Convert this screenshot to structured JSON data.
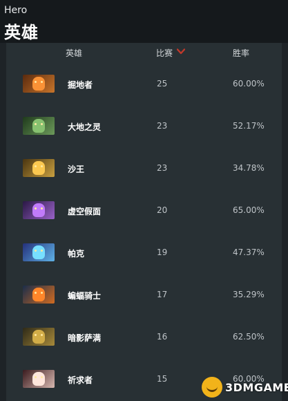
{
  "header": {
    "small_title": "Hero",
    "big_title": "英雄"
  },
  "table": {
    "col_hero": "英雄",
    "col_matches": "比赛",
    "col_winrate": "胜率",
    "sort_icon": "chevron-down-icon",
    "sort_color": "#c0392b"
  },
  "rows": [
    {
      "hero": "掘地者",
      "matches": "25",
      "winrate": "60.00%",
      "portrait_colors": [
        "#5a2a0e",
        "#c8752b"
      ]
    },
    {
      "hero": "大地之灵",
      "matches": "23",
      "winrate": "52.17%",
      "portrait_colors": [
        "#1f3a1c",
        "#6c9a5a"
      ]
    },
    {
      "hero": "沙王",
      "matches": "23",
      "winrate": "34.78%",
      "portrait_colors": [
        "#4a3510",
        "#c9a040"
      ]
    },
    {
      "hero": "虚空假面",
      "matches": "20",
      "winrate": "65.00%",
      "portrait_colors": [
        "#2a1845",
        "#9a62c8"
      ]
    },
    {
      "hero": "帕克",
      "matches": "19",
      "winrate": "47.37%",
      "portrait_colors": [
        "#24307a",
        "#5fb2e6"
      ]
    },
    {
      "hero": "蝙蝠骑士",
      "matches": "17",
      "winrate": "35.29%",
      "portrait_colors": [
        "#1a2d4a",
        "#d06b22"
      ]
    },
    {
      "hero": "暗影萨满",
      "matches": "16",
      "winrate": "62.50%",
      "portrait_colors": [
        "#2e2a18",
        "#a88a3a"
      ]
    },
    {
      "hero": "祈求者",
      "matches": "15",
      "winrate": "60.00%",
      "portrait_colors": [
        "#3a1a1e",
        "#d8b8b0"
      ]
    }
  ],
  "watermark": {
    "text": "3DMGAME"
  }
}
